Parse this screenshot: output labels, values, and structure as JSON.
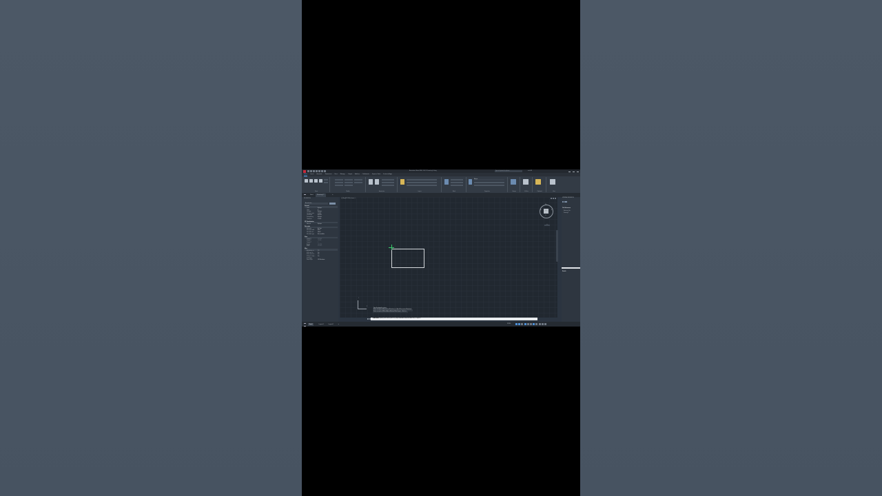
{
  "window": {
    "title": "Autodesk AutoCAD 2023   Drawing1.dwg",
    "search_placeholder": "Type a keyword or phrase",
    "user": "autifill"
  },
  "ribbon": {
    "tabs": [
      "Home",
      "Insert",
      "Annotate",
      "Parametric",
      "View",
      "Manage",
      "Output",
      "Add-ins",
      "Collaborate",
      "Express Tools",
      "Featured Apps"
    ],
    "active_tab": "Home",
    "panels": [
      "Draw",
      "Modify",
      "Annotation",
      "Layers",
      "Block",
      "Properties",
      "Groups",
      "Utilities",
      "Clipboard",
      "View"
    ],
    "bylayer": "ByLayer"
  },
  "file_tabs": {
    "start": "Start",
    "drawing": "Drawing1*",
    "plus": "+"
  },
  "properties": {
    "header": "PROPERTIES",
    "selection": "No selection",
    "groups": [
      {
        "name": "General",
        "rows": [
          {
            "k": "Color",
            "v": "ByLayer"
          },
          {
            "k": "Layer",
            "v": "0"
          },
          {
            "k": "Linetype",
            "v": "ByLayer"
          },
          {
            "k": "Linetype scale",
            "v": "1.0000"
          },
          {
            "k": "Lineweight",
            "v": "ByLayer"
          },
          {
            "k": "Transparency",
            "v": "ByLayer"
          },
          {
            "k": "Thickness",
            "v": "0.0000"
          }
        ]
      },
      {
        "name": "3D Visualization",
        "rows": [
          {
            "k": "Material",
            "v": "ByLayer"
          }
        ]
      },
      {
        "name": "Plot style",
        "rows": [
          {
            "k": "Plot style",
            "v": "ByColor"
          },
          {
            "k": "Plot style table",
            "v": "None"
          },
          {
            "k": "Plot table att...",
            "v": "Model"
          },
          {
            "k": "Plot table type",
            "v": "Not available"
          }
        ]
      },
      {
        "name": "View",
        "rows": [
          {
            "k": "Center X",
            "v": "15.1563"
          },
          {
            "k": "Center Y",
            "v": "7.6104"
          },
          {
            "k": "Center Z",
            "v": "0"
          },
          {
            "k": "Height",
            "v": "15.2214"
          },
          {
            "k": "Width",
            "v": "31.3223"
          }
        ]
      },
      {
        "name": "Misc",
        "rows": [
          {
            "k": "Annotation sc...",
            "v": "1:1"
          },
          {
            "k": "UCS icon On",
            "v": "Yes"
          },
          {
            "k": "UCS icon at or...",
            "v": "Yes"
          },
          {
            "k": "UCS per viewp...",
            "v": "Yes"
          },
          {
            "k": "UCS Name",
            "v": ""
          },
          {
            "k": "Visual Style",
            "v": "2D Wireframe"
          }
        ]
      }
    ]
  },
  "viewport": {
    "label": "[-][Top][2D Wireframe]",
    "viewcube_face": "TOP",
    "dirs": {
      "n": "N",
      "s": "S",
      "e": "E",
      "w": "W"
    },
    "wcs": "WCS",
    "ucs_x": "X",
    "ucs_y": "Y"
  },
  "command": {
    "history": [
      "Specify opposite corner:",
      "Enter an option [Dimensions/Rotation]  or  [Area/Dimensions/Rotation]:",
      "Enter an option [ENtire/Above/Bottom/Plan/Layer]: <Entire>:"
    ],
    "prompt_cmd": "- MAXIMIZE",
    "prompt_text": "Specify first corner point or [Object Add Area Subtract Area Exit] <Object>:"
  },
  "xref": {
    "header": "EXTERNAL REFERENCES",
    "file_refs": "File References",
    "item1": "Reference Na...",
    "item2": "Drawing1*",
    "details": "Details"
  },
  "status": {
    "tabs": [
      "Model",
      "Layout1",
      "Layout2"
    ],
    "active": "Model",
    "plus": "+",
    "model_button": "MODEL"
  }
}
